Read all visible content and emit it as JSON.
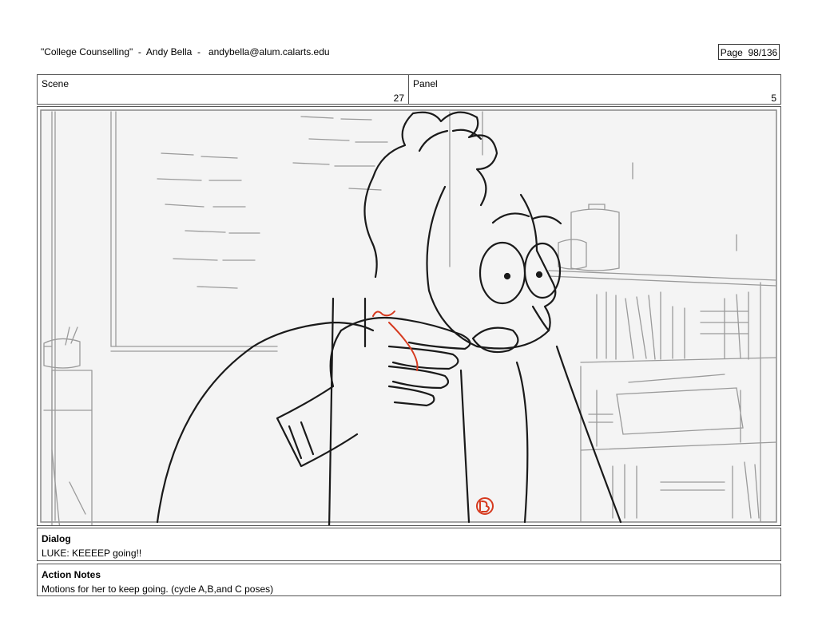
{
  "header": {
    "title": "\"College Counselling\"  -  Andy Bella  -   andybella@alum.calarts.edu",
    "page": "Page  98/136"
  },
  "scene": {
    "label": "Scene",
    "value": "27"
  },
  "panel": {
    "label": "Panel",
    "value": "5"
  },
  "dialog": {
    "label": "Dialog",
    "text": "LUKE: KEEEEP going!!"
  },
  "action_notes": {
    "label": "Action Notes",
    "text": "Motions for her to keep going. (cycle A,B,and C poses)"
  },
  "colors": {
    "sketch": "#1a1a1a",
    "background_sketch": "#9a9a9a",
    "red_pencil": "#d63a1f"
  }
}
